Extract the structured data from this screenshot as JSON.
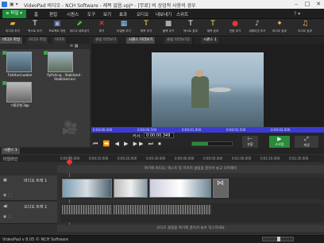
{
  "window": {
    "title": "VideoPad 비디오 - NCH Software - 제목 없음.vpj* - [무료] 비 상업적 사용의 경우"
  },
  "menu": {
    "file": "≡ 파일 ▾",
    "items": [
      "홈",
      "편집",
      "시퀀스",
      "도구",
      "보기",
      "효과",
      "오디오",
      "내보내기",
      "스위트"
    ]
  },
  "toolbar": [
    {
      "label": "미디어 추가",
      "icon": "folder-plus-icon"
    },
    {
      "label": "텍스트 추가",
      "icon": "text-icon"
    },
    {
      "label": "프로젝트 저장",
      "icon": "save-icon"
    },
    {
      "label": "비디오 내보내기",
      "icon": "export-icon"
    },
    {
      "label": "제거",
      "icon": "remove-icon"
    },
    {
      "label": "타일링 추가",
      "icon": "tile-icon"
    },
    {
      "label": "제목 추가",
      "icon": "title-icon"
    },
    {
      "label": "블랙 추가",
      "icon": "black-icon"
    },
    {
      "label": "텍스트 효과",
      "icon": "text-fx-icon"
    },
    {
      "label": "제목 효과",
      "icon": "title-fx-icon"
    },
    {
      "label": "전환 추가",
      "icon": "transition-icon"
    },
    {
      "label": "내레이션 추가",
      "icon": "mic-icon"
    },
    {
      "label": "비디오 효과",
      "icon": "video-fx-icon"
    },
    {
      "label": "오디오 효과",
      "icon": "audio-fx-icon"
    }
  ],
  "bin": {
    "tabs": [
      "비디오 파일",
      "오디오 파일",
      "이미지"
    ],
    "items": [
      {
        "name": "FishHard.webm"
      },
      {
        "name": "flyfishing - Stabilized - Stabilized.avi"
      },
      {
        "name": "기울준형.3gp"
      }
    ]
  },
  "preview": {
    "tabs": [
      "클립 미리보기",
      "시퀀스 미리보기",
      "클립 미리보기2",
      "시퀀스 1"
    ],
    "position_label": "커서:",
    "position": "0:00:00.349",
    "ruler_marks": [
      "0:00:00.000",
      "0:00:00.500",
      "0:00:01.000",
      "0:00:01.500",
      "0:00:02.000",
      "0:00:02.500"
    ],
    "split": "분할",
    "scrub": "스크럽",
    "playback": "재생"
  },
  "timeline": {
    "tabs": [
      "시퀀스 1"
    ],
    "label": "타임라인",
    "times": [
      "0:00:00.000",
      "0:00:10.000",
      "0:00:20.000",
      "0:00:30.000",
      "0:00:40.000",
      "0:00:50.000",
      "0:01:00.000",
      "0:01:10.000",
      "0:01:20.000"
    ],
    "video_hint": "여기에 비디오, 텍스트 및 이미지 클립을 끌어서 놓고 오버레이",
    "video_track": "비디오 트랙 1",
    "audio_track": "오디오 트랙 1",
    "audio_hint": "오디오 클립을 여기에 끌어서 놓아 믹스하세요"
  },
  "status": {
    "text": "VideoPad v 8.05 © NCH Software"
  }
}
